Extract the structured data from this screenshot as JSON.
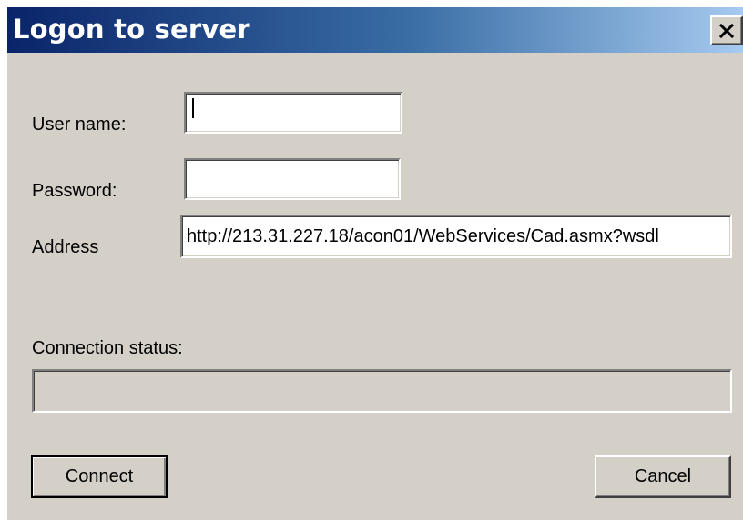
{
  "window": {
    "title": "Logon to server",
    "close_icon": "close-x-icon"
  },
  "form": {
    "username_label": "User name:",
    "username_value": "",
    "password_label": "Password:",
    "password_value": "",
    "address_label": "Address",
    "address_value": "http://213.31.227.18/acon01/WebServices/Cad.asmx?wsdl",
    "status_label": "Connection status:",
    "status_value": ""
  },
  "buttons": {
    "connect_label": "Connect",
    "cancel_label": "Cancel"
  },
  "colors": {
    "title_gradient_start": "#0a246a",
    "title_gradient_end": "#a6caf0",
    "dialog_face": "#d4d0c8"
  }
}
